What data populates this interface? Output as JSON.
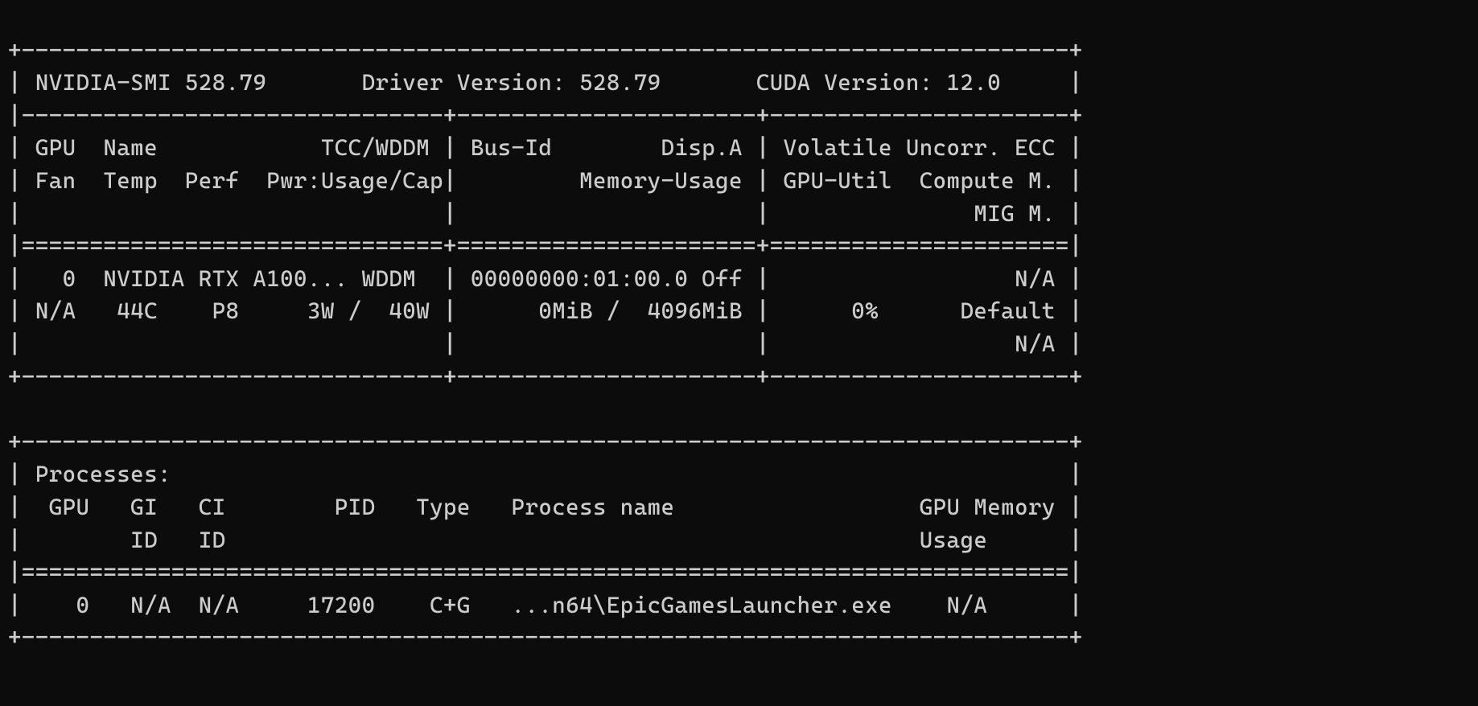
{
  "borders": {
    "top": "+-----------------------------------------------------------------------------+",
    "sep1": "|-------------------------------+----------------------+----------------------+",
    "sep2": "|===============================+======================+======================|",
    "bottom1": "+-------------------------------+----------------------+----------------------+",
    "top2": "+-----------------------------------------------------------------------------+",
    "sep3": "|=============================================================================|",
    "bottom2": "+-----------------------------------------------------------------------------+",
    "pipe_pad": "| ",
    "pipe_nospace": "|",
    "pipe_mid": " | ",
    "pipe_mid_end": " |",
    "pipe_end": "|"
  },
  "header": {
    "smi": "NVIDIA-SMI 528.79       ",
    "driver": "Driver Version: 528.79       ",
    "cuda": "CUDA Version: 12.0     "
  },
  "cols": {
    "r1c1": "GPU  Name            TCC/WDDM",
    "r1c2": "Bus-Id        Disp.A",
    "r1c3": "Volatile Uncorr. ECC",
    "r2c1": "Fan  Temp  Perf  Pwr:Usage/Cap",
    "r2c2": "         Memory-Usage",
    "r2c3": "GPU-Util  Compute M.",
    "r3c1": "                             ",
    "r3c2": "                    ",
    "r3c3": "              MIG M."
  },
  "gpu": {
    "line1c1": "  0  NVIDIA RTX A100... WDDM ",
    "line1c2": "00000000:01:00.0 Off",
    "line1c3": "                 N/A",
    "line2c1": "N/A   44C    P8     3W /  40W",
    "line2c2": "     0MiB /  4096MiB",
    "line2c3": "     0%      Default",
    "line3c1": "                             ",
    "line3c2": "                    ",
    "line3c3": "                 N/A"
  },
  "proc": {
    "title": "Processes:                                                                  ",
    "header1": "  GPU   GI   CI        PID   Type   Process name                  GPU Memory ",
    "header2": "        ID   ID                                                   Usage      ",
    "row1": "    0   N/A  N/A     17200    C+G   ...n64\\EpicGamesLauncher.exe    N/A      "
  },
  "chart_data": {
    "type": "table",
    "nvidia_smi_version": "528.79",
    "driver_version": "528.79",
    "cuda_version": "12.0",
    "gpus": [
      {
        "id": 0,
        "name": "NVIDIA RTX A100",
        "mode": "WDDM",
        "bus_id": "00000000:01:00.0",
        "display_active": "Off",
        "ecc": "N/A",
        "fan": "N/A",
        "temperature_c": 44,
        "perf_state": "P8",
        "power_usage_w": 3,
        "power_cap_w": 40,
        "memory_used_mib": 0,
        "memory_total_mib": 4096,
        "gpu_utilization_pct": 0,
        "compute_mode": "Default",
        "mig_mode": "N/A"
      }
    ],
    "processes": [
      {
        "gpu": 0,
        "gi_id": "N/A",
        "ci_id": "N/A",
        "pid": 17200,
        "type": "C+G",
        "process_name": "...n64\\EpicGamesLauncher.exe",
        "gpu_memory_usage": "N/A"
      }
    ]
  }
}
